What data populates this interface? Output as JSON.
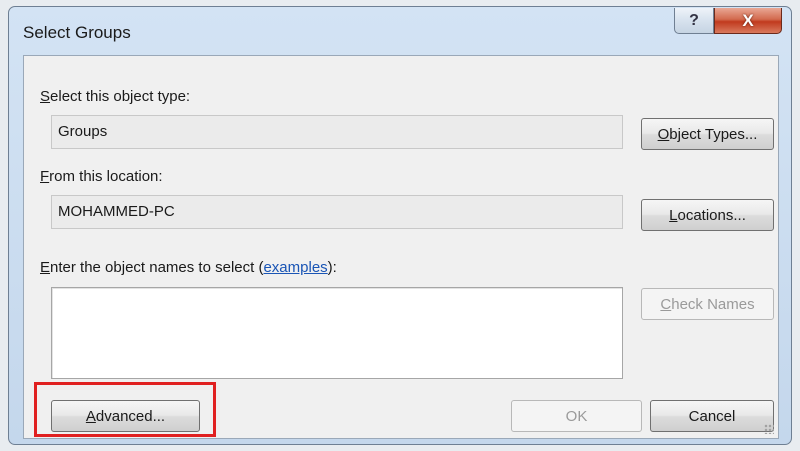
{
  "dialog": {
    "title": "Select Groups",
    "help_glyph": "?",
    "close_glyph": "X"
  },
  "object_type": {
    "label_key": "S",
    "label_rest": "elect this object type:",
    "value": "Groups",
    "button_key": "O",
    "button_rest": "bject Types..."
  },
  "location": {
    "label_key": "F",
    "label_rest": "rom this location:",
    "value": "MOHAMMED-PC",
    "button_key": "L",
    "button_rest": "ocations..."
  },
  "names": {
    "label_key": "E",
    "label_rest": "nter the object names to select (",
    "link_text": "examples",
    "label_tail": "):",
    "value": "",
    "check_key": "C",
    "check_rest": "heck Names"
  },
  "footer": {
    "advanced_key": "A",
    "advanced_rest": "dvanced...",
    "ok_label": "OK",
    "cancel_label": "Cancel"
  },
  "colors": {
    "highlight": "#e02020",
    "link": "#1a55b5"
  }
}
